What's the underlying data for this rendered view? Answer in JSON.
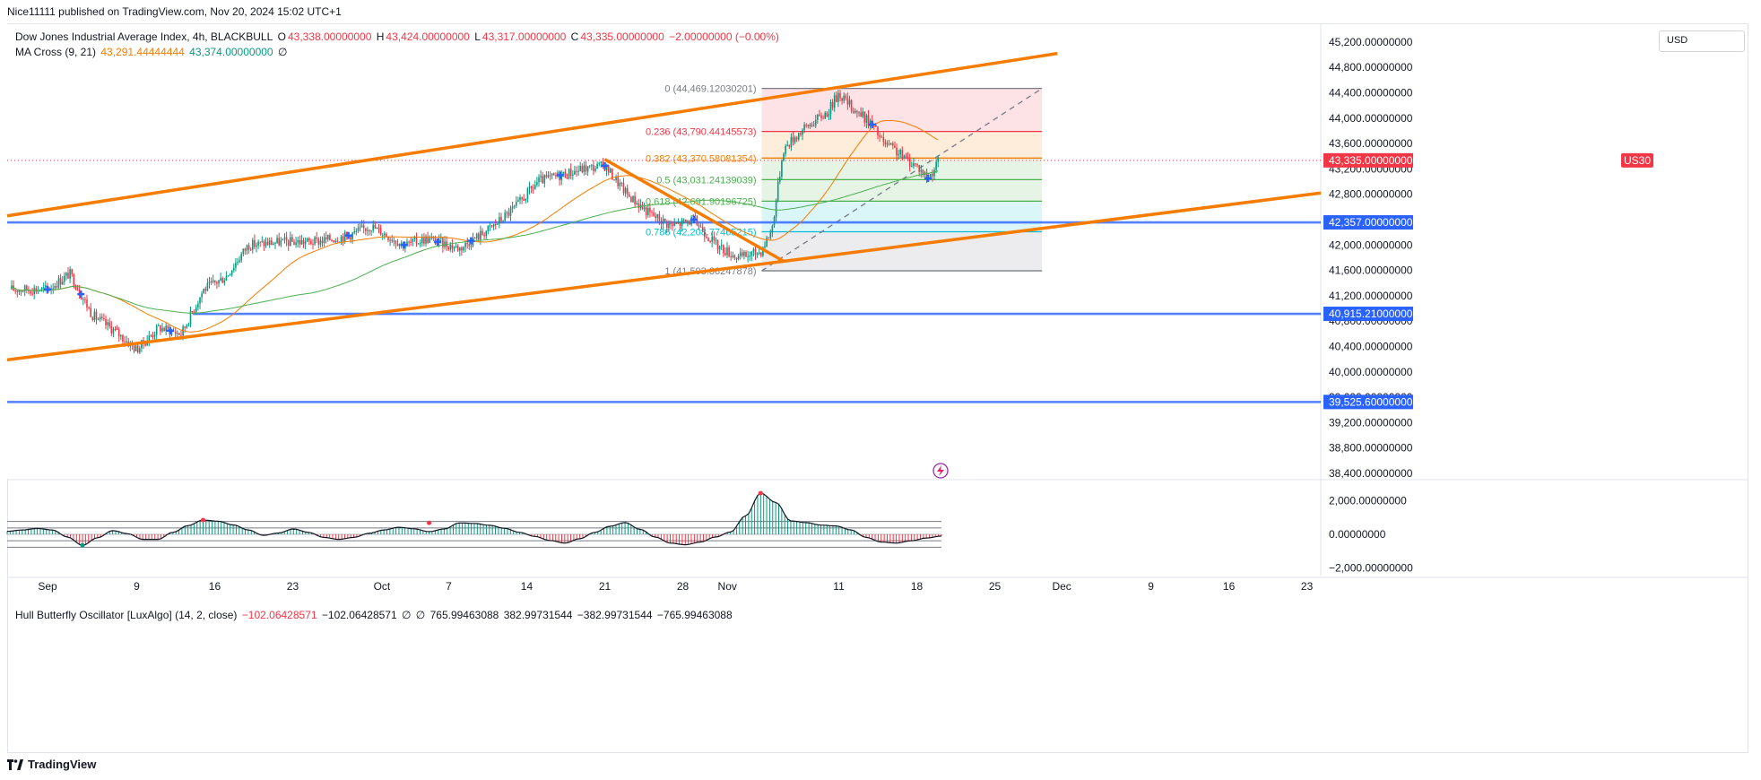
{
  "header": {
    "published": "Nice11111 published on TradingView.com, Nov 20, 2024 15:02 UTC+1"
  },
  "legend": {
    "title": "Dow Jones Industrial Average Index, 4h, BLACKBULL",
    "o_label": "O",
    "o_value": "43,338.00000000",
    "h_label": "H",
    "h_value": "43,424.00000000",
    "l_label": "L",
    "l_value": "43,317.00000000",
    "c_label": "C",
    "c_value": "43,335.00000000",
    "change": "−2.00000000 (−0.00%)",
    "ma_name": "MA Cross (9, 21)",
    "ma_fast": "43,291.44444444",
    "ma_slow": "43,374.00000000",
    "ma_sym": "∅"
  },
  "oscillator_legend": {
    "name": "Hull Butterfly Oscillator [LuxAlgo] (14, 2, close)",
    "v1": "−102.06428571",
    "v2": "−102.06428571",
    "v3": "∅",
    "v4": "∅",
    "v5": "765.99463088",
    "v6": "382.99731544",
    "v7": "−382.99731544",
    "v8": "−765.99463088"
  },
  "currency_box": "USD",
  "footer": {
    "brand": "TradingView"
  },
  "colors": {
    "up": "#089981",
    "down": "#f23645",
    "trend": "#f57c00",
    "hline": "#2962ff",
    "ma_fast": "#f57c00",
    "ma_slow": "#4caf50",
    "fib_red": "#f23645",
    "fib_orange": "#f57c00",
    "fib_green": "#4caf50",
    "fib_teal": "#00bcd4",
    "fib_gray": "#787b86"
  },
  "chart_data": [
    {
      "type": "candlestick",
      "title": "Dow Jones Industrial Average Index, 4h, BLACKBULL",
      "timeframe": "4h",
      "currency": "USD",
      "x_tick_labels": [
        "Sep",
        "9",
        "16",
        "23",
        "Oct",
        "7",
        "14",
        "21",
        "28",
        "Nov",
        "11",
        "18",
        "25",
        "Dec",
        "9",
        "16",
        "23"
      ],
      "y_tick_labels": [
        "45,200.00000000",
        "44,800.00000000",
        "44,400.00000000",
        "44,000.00000000",
        "43,600.00000000",
        "43,200.00000000",
        "42,800.00000000",
        "42,400.00000000",
        "42,000.00000000",
        "41,600.00000000",
        "41,200.00000000",
        "40,800.00000000",
        "40,400.00000000",
        "40,000.00000000",
        "39,600.00000000",
        "39,200.00000000",
        "38,800.00000000",
        "38,400.00000000"
      ],
      "y_tick_values": [
        45200,
        44800,
        44400,
        44000,
        43600,
        43200,
        42800,
        42400,
        42000,
        41600,
        41200,
        40800,
        40400,
        40000,
        39600,
        39200,
        38800,
        38400
      ],
      "ylim": [
        38200,
        45400
      ],
      "price_path": [
        {
          "date": "Sep 1",
          "close": 41300
        },
        {
          "date": "Sep 3",
          "close": 41550
        },
        {
          "date": "Sep 5",
          "close": 40900
        },
        {
          "date": "Sep 7",
          "close": 40650
        },
        {
          "date": "Sep 9",
          "close": 40350
        },
        {
          "date": "Sep 11",
          "close": 40700
        },
        {
          "date": "Sep 13",
          "close": 40600
        },
        {
          "date": "Sep 15",
          "close": 41300
        },
        {
          "date": "Sep 17",
          "close": 41500
        },
        {
          "date": "Sep 19",
          "close": 42000
        },
        {
          "date": "Sep 22",
          "close": 42050
        },
        {
          "date": "Sep 25",
          "close": 42050
        },
        {
          "date": "Sep 28",
          "close": 42150
        },
        {
          "date": "Sep 30",
          "close": 42300
        },
        {
          "date": "Oct 3",
          "close": 42000
        },
        {
          "date": "Oct 5",
          "close": 42100
        },
        {
          "date": "Oct 8",
          "close": 41950
        },
        {
          "date": "Oct 11",
          "close": 42300
        },
        {
          "date": "Oct 13",
          "close": 42600
        },
        {
          "date": "Oct 15",
          "close": 43000
        },
        {
          "date": "Oct 17",
          "close": 43100
        },
        {
          "date": "Oct 19",
          "close": 43200
        },
        {
          "date": "Oct 21",
          "close": 43250
        },
        {
          "date": "Oct 23",
          "close": 42800
        },
        {
          "date": "Oct 25",
          "close": 42500
        },
        {
          "date": "Oct 27",
          "close": 42300
        },
        {
          "date": "Oct 29",
          "close": 42400
        },
        {
          "date": "Oct 31",
          "close": 42000
        },
        {
          "date": "Nov 2",
          "close": 41800
        },
        {
          "date": "Nov 4",
          "close": 41900
        },
        {
          "date": "Nov 5",
          "close": 42250
        },
        {
          "date": "Nov 6",
          "close": 43500
        },
        {
          "date": "Nov 7",
          "close": 43700
        },
        {
          "date": "Nov 8",
          "close": 43850
        },
        {
          "date": "Nov 10",
          "close": 44100
        },
        {
          "date": "Nov 11",
          "close": 44400
        },
        {
          "date": "Nov 12",
          "close": 44200
        },
        {
          "date": "Nov 13",
          "close": 44050
        },
        {
          "date": "Nov 14",
          "close": 43900
        },
        {
          "date": "Nov 15",
          "close": 43600
        },
        {
          "date": "Nov 16",
          "close": 43500
        },
        {
          "date": "Nov 17",
          "close": 43350
        },
        {
          "date": "Nov 18",
          "close": 43250
        },
        {
          "date": "Nov 19",
          "close": 43050
        },
        {
          "date": "Nov 20",
          "close": 43335
        }
      ],
      "series": [
        {
          "name": "MA Cross (9, 21)",
          "last_fast": 43291.44444444,
          "last_slow": 43374.0
        }
      ],
      "fibonacci": [
        {
          "level": "0",
          "price": 44469.12030201,
          "label": "0 (44,469.12030201)"
        },
        {
          "level": "0.236",
          "price": 43790.44145573,
          "label": "0.236 (43,790.44145573)"
        },
        {
          "level": "0.382",
          "price": 43370.58081354,
          "label": "0.382 (43,370.58081354)"
        },
        {
          "level": "0.5",
          "price": 43031.24139039,
          "label": "0.5 (43,031.24139039)"
        },
        {
          "level": "0.618",
          "price": 42691.90196725,
          "label": "0.618 (42,691.90196725)"
        },
        {
          "level": "0.786",
          "price": 42208.77465215,
          "label": "0.786 (42,208.77465215)"
        },
        {
          "level": "1",
          "price": 41593.36247878,
          "label": "1 (41,593.36247878)"
        }
      ],
      "horizontal_levels": [
        {
          "price": 42357.0,
          "label": "42,357.00000000"
        },
        {
          "price": 40915.21,
          "label": "40,915.21000000"
        },
        {
          "price": 39525.6,
          "label": "39,525.60000000"
        }
      ],
      "symbol_tag": {
        "name": "US30",
        "price": 43335.0,
        "label": "43,335.00000000"
      },
      "trend_channel": {
        "upper": [
          {
            "date": "Aug 29",
            "price": 42460
          },
          {
            "date": "Dec 25",
            "price": 44600
          }
        ],
        "lower": [
          {
            "date": "Aug 29",
            "price": 40190
          },
          {
            "date": "Dec 25",
            "price": 42470
          }
        ]
      },
      "descending_trendline": [
        {
          "date": "Oct 21",
          "price": 43350
        },
        {
          "date": "Nov 6",
          "price": 41750
        }
      ]
    },
    {
      "type": "bar",
      "title": "Hull Butterfly Oscillator [LuxAlgo] (14, 2, close)",
      "y_tick_labels": [
        "2,000.00000000",
        "0.00000000",
        "−2,000.00000000"
      ],
      "y_tick_values": [
        2000,
        0,
        -2000
      ],
      "ylim": [
        -2600,
        3000
      ],
      "levels": [
        765.99463088,
        382.99731544,
        -382.99731544,
        -765.99463088
      ],
      "last_value": -102.06428571,
      "values": [
        180,
        260,
        350,
        260,
        -160,
        -650,
        -200,
        220,
        40,
        -300,
        -300,
        120,
        520,
        850,
        780,
        560,
        260,
        -60,
        80,
        320,
        120,
        -180,
        -300,
        -180,
        60,
        260,
        420,
        330,
        160,
        320,
        680,
        650,
        540,
        360,
        120,
        -120,
        -360,
        -520,
        -260,
        120,
        480,
        700,
        300,
        -160,
        -520,
        -620,
        -460,
        -160,
        140,
        1100,
        2450,
        1900,
        800,
        700,
        550,
        500,
        260,
        -180,
        -460,
        -520,
        -380,
        -220,
        -102
      ]
    }
  ]
}
